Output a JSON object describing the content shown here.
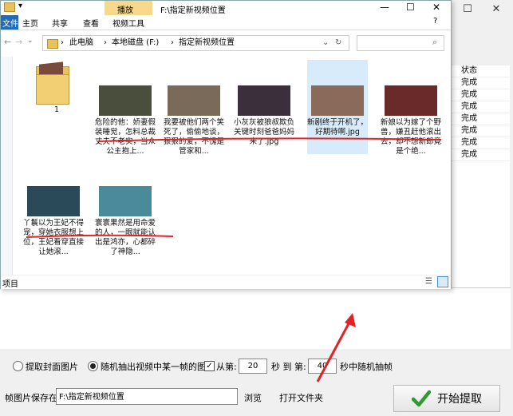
{
  "app": {
    "status_header": "状态",
    "status_values": [
      "完成",
      "完成",
      "完成",
      "完成",
      "完成",
      "完成",
      "完成"
    ],
    "options": {
      "cover_label": "提取封面图片",
      "random_label": "随机抽出视频中某一帧的图片",
      "from_label": "从第:",
      "from_value": "20",
      "sec_to_label": "秒 到 第:",
      "to_value": "40",
      "tail_label": "秒中随机抽帧"
    },
    "save": {
      "label": "帧图片保存在:",
      "path": "F:\\指定新视频位置",
      "browse_label": "浏览",
      "open_folder_label": "打开文件夹",
      "start_label": "开始提取"
    },
    "accent_color": "#2e9b2e",
    "arrow_color": "#e02424"
  },
  "explorer": {
    "title": "F:\\指定新视频位置",
    "ribbon_tabs": [
      "文件",
      "主页",
      "共享",
      "查看"
    ],
    "context_tab_group": "播放",
    "context_tab": "视频工具",
    "breadcrumb": [
      "此电脑",
      "本地磁盘 (F:)",
      "指定新视频位置"
    ],
    "status_text": "项目",
    "items": [
      {
        "name": "1",
        "kind": "folder"
      },
      {
        "name": "危险的他：娇妻假装睡觉，怎料总裁丈夫不老实，当众公主抱上...",
        "kind": "video",
        "thumb": "#4a4e3c"
      },
      {
        "name": "我要被他们两个笑死了，偷偷地谈，狠狠的爱，不愧是管家和...",
        "kind": "video",
        "thumb": "#7a6a5a"
      },
      {
        "name": "小灰灰被狼叔欺负关键时刻爸爸妈妈来了.jpg",
        "kind": "video",
        "thumb": "#3a2f3a"
      },
      {
        "name": "新剧终于开机了，好期待啊.jpg",
        "kind": "video",
        "thumb": "#8a6a5a",
        "selected": true
      },
      {
        "name": "新娘以为嫁了个野兽，嫌丑赶他滚出去，却不想新郎竟是个绝...",
        "kind": "video",
        "thumb": "#6a2a2a"
      },
      {
        "name": "丫鬟以为王妃不得宠，穿她衣服想上位，王妃看穿直接让她滚...",
        "kind": "video",
        "thumb": "#2a4a5a"
      },
      {
        "name": "寰寰果然是用命爱的人，一眼就能认出是鸿亦，心都碎了神隐...",
        "kind": "video",
        "thumb": "#4a8a9a"
      }
    ]
  }
}
